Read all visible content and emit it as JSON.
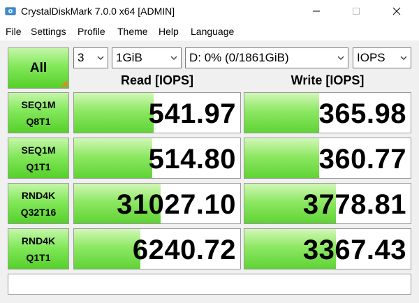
{
  "window": {
    "title": "CrystalDiskMark 7.0.0 x64 [ADMIN]"
  },
  "menu": [
    "File",
    "Settings",
    "Profile",
    "Theme",
    "Help",
    "Language"
  ],
  "controls": {
    "all_label": "All",
    "count": "3",
    "size": "1GiB",
    "drive": "D: 0% (0/1861GiB)",
    "unit": "IOPS"
  },
  "headers": {
    "read": "Read [IOPS]",
    "write": "Write [IOPS]"
  },
  "rows": [
    {
      "line1": "SEQ1M",
      "line2": "Q8T1",
      "read": "541.97",
      "write": "365.98",
      "read_level": 0.48,
      "write_level": 0.45
    },
    {
      "line1": "SEQ1M",
      "line2": "Q1T1",
      "read": "514.80",
      "write": "360.77",
      "read_level": 0.47,
      "write_level": 0.45
    },
    {
      "line1": "RND4K",
      "line2": "Q32T16",
      "read": "31027.10",
      "write": "3778.81",
      "read_level": 0.52,
      "write_level": 0.55
    },
    {
      "line1": "RND4K",
      "line2": "Q1T1",
      "read": "6240.72",
      "write": "3367.43",
      "read_level": 0.4,
      "write_level": 0.55
    }
  ],
  "status": "",
  "colors": {
    "accent_green": "#55d02a",
    "corner_orange": "#e8842a"
  }
}
